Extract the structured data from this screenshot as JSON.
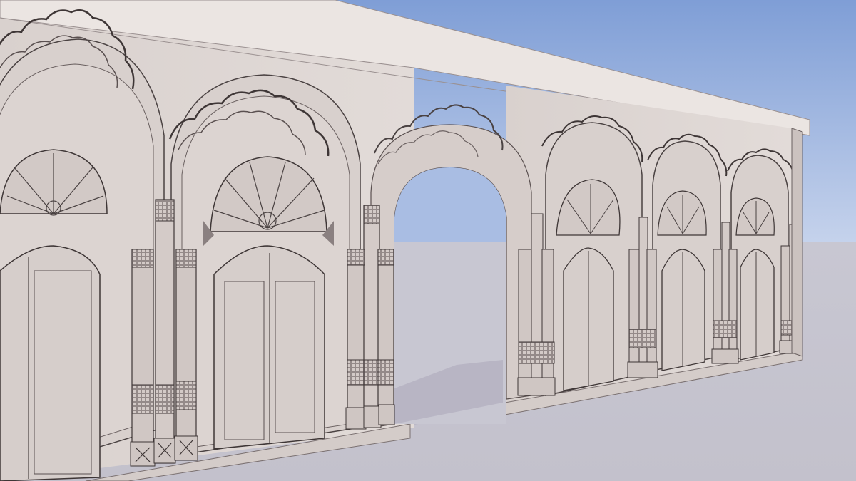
{
  "scene": {
    "subject": "ornate-arched-wall-3d-render",
    "colors": {
      "sky_top": "#7f9ed6",
      "sky_bottom": "#c6d3ec",
      "ground_far": "#c8c7d2",
      "ground_near": "#c3c1cc",
      "wall": "#dcd4d1",
      "wall_shade": "#c9bfbb",
      "cornice": "#ebe5e2",
      "line": "#4a4242",
      "shadow": "#b3b1c0"
    }
  }
}
